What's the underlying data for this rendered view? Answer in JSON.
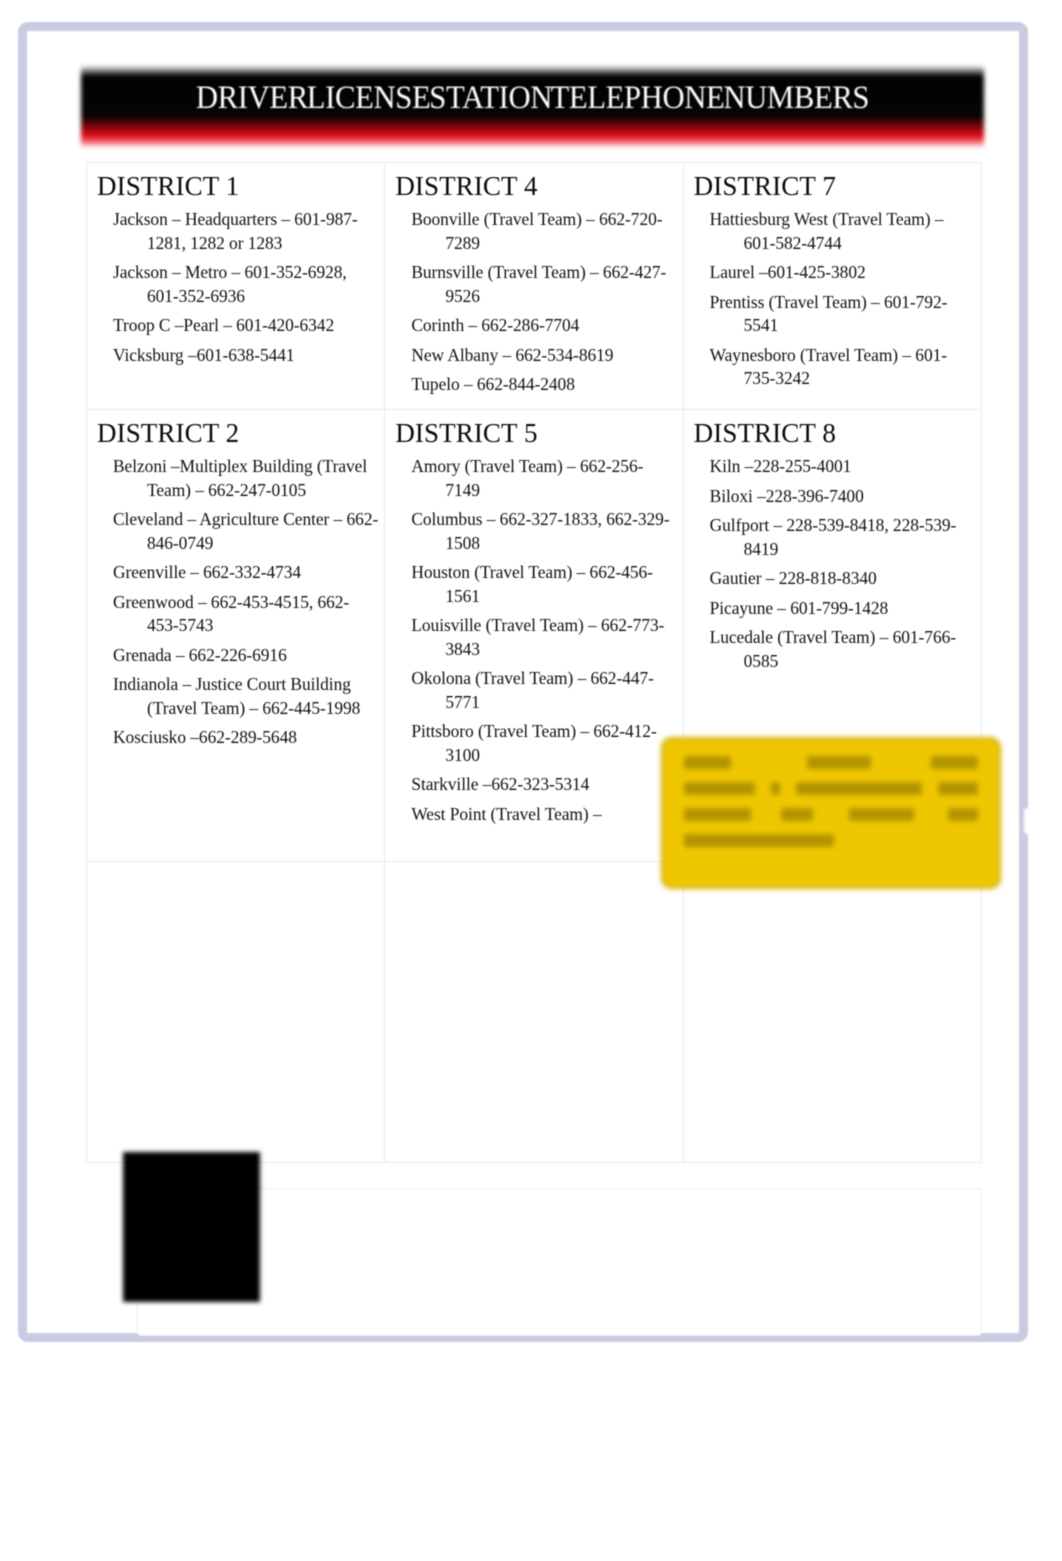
{
  "slide": {
    "title": "DRIVER LICENSE STATION TELEPHONE NUMBERS",
    "frame_color": "#c9cbe1",
    "banner_top_color": "#000000",
    "banner_accent_color": "#e0121c"
  },
  "districts": [
    {
      "name": "DISTRICT 1",
      "stations": [
        "Jackson – Headquarters – 601-987-1281, 1282 or 1283",
        "Jackson – Metro – 601-352-6928, 601-352-6936",
        "Troop C –Pearl – 601-420-6342",
        "Vicksburg –601-638-5441"
      ]
    },
    {
      "name": "DISTRICT 4",
      "stations": [
        "Boonville (Travel Team) – 662-720-7289",
        "Burnsville (Travel Team) – 662-427-9526",
        "Corinth – 662-286-7704",
        "New Albany – 662-534-8619",
        "Tupelo –  662-844-2408"
      ]
    },
    {
      "name": "DISTRICT 7",
      "stations": [
        "Hattiesburg West (Travel Team) – 601-582-4744",
        "Laurel –601-425-3802",
        "Prentiss (Travel Team) – 601-792-5541",
        "Waynesboro (Travel Team) – 601-735-3242"
      ]
    },
    {
      "name": "DISTRICT 2",
      "stations": [
        "Belzoni –Multiplex Building (Travel Team) – 662-247-0105",
        "Cleveland – Agriculture Center – 662-846-0749",
        "Greenville – 662-332-4734",
        "Greenwood –  662-453-4515, 662-453-5743",
        "Grenada –  662-226-6916",
        "Indianola –  Justice Court Building (Travel Team) – 662-445-1998",
        "Kosciusko –662-289-5648"
      ]
    },
    {
      "name": "DISTRICT 5",
      "stations": [
        "Amory (Travel Team) – 662-256-7149",
        "Columbus – 662-327-1833, 662-329-1508",
        "Houston (Travel Team) – 662-456-1561",
        "Louisville (Travel Team) – 662-773-3843",
        "Okolona (Travel Team) – 662-447-5771",
        "Pittsboro (Travel Team) – 662-412-3100",
        "Starkville –662-323-5314",
        "West Point (Travel Team) –"
      ]
    },
    {
      "name": "DISTRICT 8",
      "stations": [
        "Kiln –228-255-4001",
        "Biloxi –228-396-7400",
        "Gulfport – 228-539-8418, 228-539-8419",
        "Gautier –  228-818-8340",
        "Picayune – 601-799-1428",
        "Lucedale (Travel Team) – 601-766-0585"
      ]
    }
  ],
  "empty_cells": [
    {
      "name": "empty-cell-col1"
    },
    {
      "name": "empty-cell-col2"
    },
    {
      "name": "empty-cell-col3"
    }
  ],
  "ghost_note": {
    "line1": "",
    "line2": ""
  },
  "redaction_box": {
    "fill_color": "#efc700",
    "border_color": "#d3b000",
    "line_count": 4,
    "content": ""
  },
  "bottom_panel": {
    "black_box_color": "#000000",
    "panel_border_color": "#ececf2",
    "content": ""
  }
}
